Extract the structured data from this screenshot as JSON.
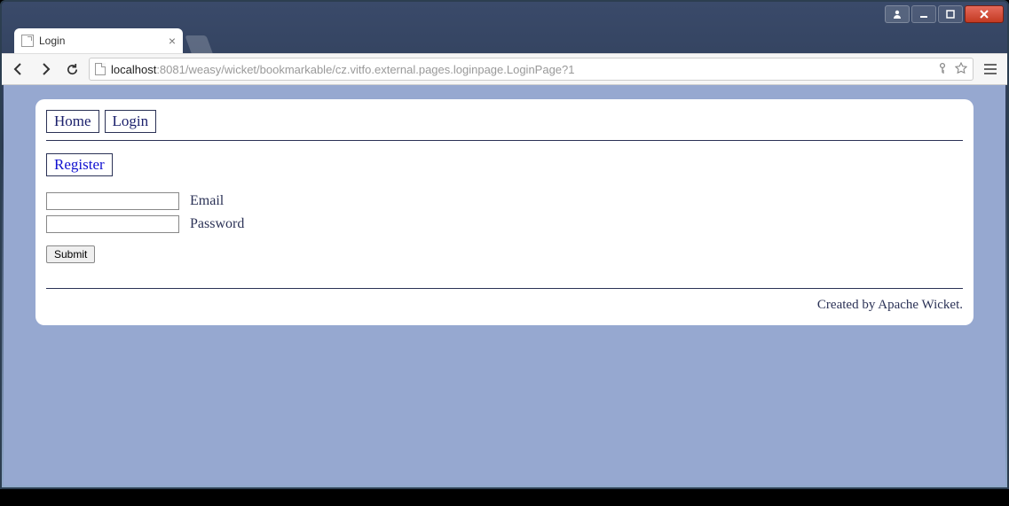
{
  "window": {
    "tab_title": "Login",
    "url_host": "localhost",
    "url_rest": ":8081/weasy/wicket/bookmarkable/cz.vitfo.external.pages.loginpage.LoginPage?1"
  },
  "page": {
    "nav": {
      "home": "Home",
      "login": "Login"
    },
    "register_link": "Register",
    "form": {
      "email_label": "Email",
      "email_value": "",
      "password_label": "Password",
      "password_value": "",
      "submit_label": "Submit"
    },
    "footer_prefix": "Created by ",
    "footer_link": "Apache Wicket",
    "footer_suffix": "."
  }
}
